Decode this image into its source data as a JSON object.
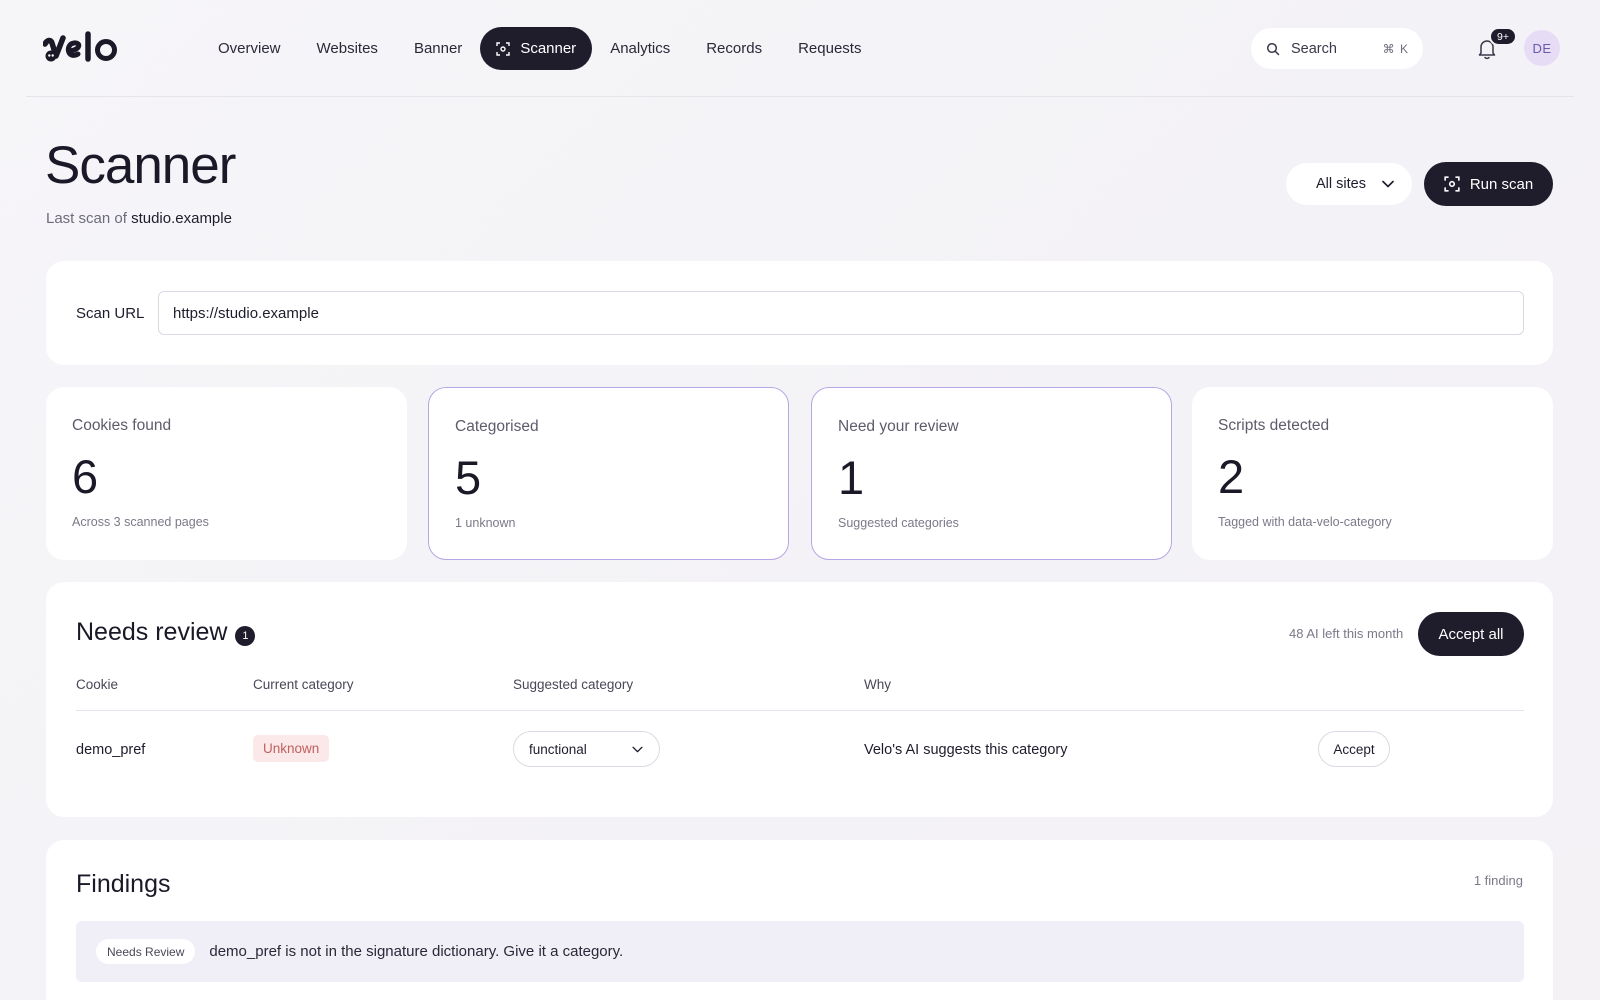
{
  "brand": {
    "logo_text": "velo"
  },
  "nav": {
    "links": [
      {
        "label": "Overview"
      },
      {
        "label": "Websites"
      },
      {
        "label": "Banner"
      },
      {
        "label": "Scanner",
        "active": true
      },
      {
        "label": "Analytics"
      },
      {
        "label": "Records"
      },
      {
        "label": "Requests"
      }
    ],
    "search": {
      "label": "Search",
      "shortcut": "⌘ K"
    },
    "notifications_badge": "9+",
    "avatar_initials": "DE"
  },
  "header": {
    "title": "Scanner",
    "subtitle_prefix": "Last scan of",
    "subtitle_site": "studio.example",
    "sites_select": "All sites",
    "run_scan_label": "Run scan"
  },
  "scan_url": {
    "label": "Scan URL",
    "value": "https://studio.example"
  },
  "stats": [
    {
      "label": "Cookies found",
      "value": "6",
      "note": "Across 3 scanned pages"
    },
    {
      "label": "Categorised",
      "value": "5",
      "note": "1 unknown"
    },
    {
      "label": "Need your review",
      "value": "1",
      "note": "Suggested categories"
    },
    {
      "label": "Scripts detected",
      "value": "2",
      "note": "Tagged with data-velo-category"
    }
  ],
  "review": {
    "title": "Needs review",
    "badge": "1",
    "ai_left": "48 AI left this month",
    "accept_all_label": "Accept all",
    "columns": {
      "cookie": "Cookie",
      "current": "Current category",
      "suggested": "Suggested category",
      "why": "Why"
    },
    "rows": [
      {
        "cookie": "demo_pref",
        "current": "Unknown",
        "suggested": "functional",
        "why": "Velo's AI suggests this category",
        "action": "Accept"
      }
    ]
  },
  "findings": {
    "title": "Findings",
    "count": "1 finding",
    "items": [
      {
        "tag": "Needs Review",
        "text": "demo_pref is not in the signature dictionary. Give it a category."
      }
    ]
  },
  "colors": {
    "primary": "#1f1c2c",
    "accent_border": "#b7a6e6",
    "unknown_bg": "#fbe8e8",
    "unknown_text": "#c0615f"
  }
}
